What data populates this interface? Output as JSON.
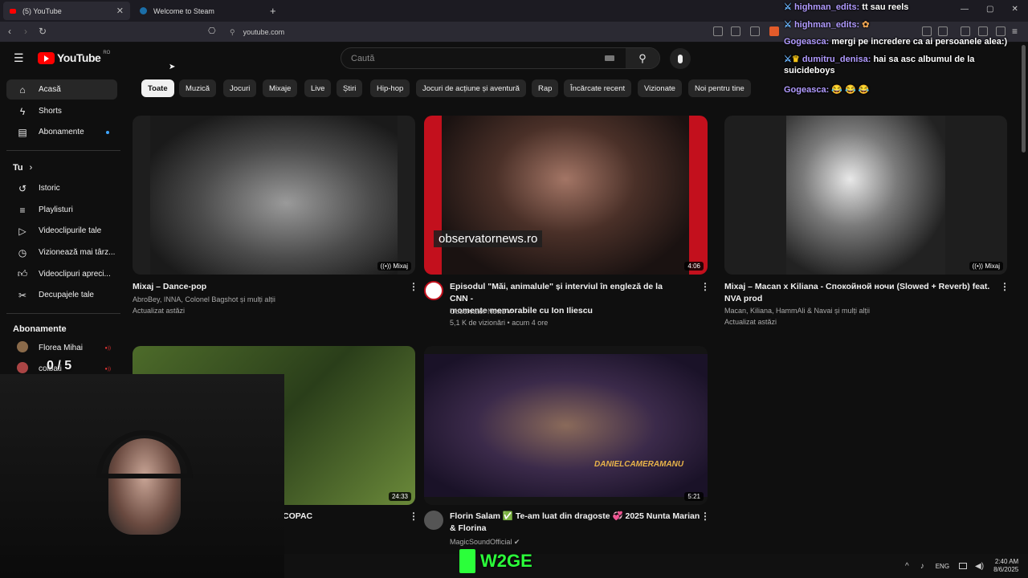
{
  "browser": {
    "tabs": [
      {
        "title": "(5) YouTube",
        "active": true
      },
      {
        "title": "Welcome to Steam",
        "active": false
      }
    ],
    "new_tab": "+",
    "url": "youtube.com",
    "window_controls": [
      "—",
      "▢",
      "✕"
    ]
  },
  "youtube": {
    "logo": "YouTube",
    "region": "RO",
    "search_placeholder": "Caută",
    "sidebar": {
      "main": [
        {
          "label": "Acasă",
          "icon": "home-icon",
          "selected": true
        },
        {
          "label": "Shorts",
          "icon": "shorts-icon"
        },
        {
          "label": "Abonamente",
          "icon": "subscriptions-icon"
        }
      ],
      "you_header": "Tu",
      "you": [
        {
          "label": "Istoric",
          "icon": "history-icon"
        },
        {
          "label": "Playlisturi",
          "icon": "playlist-icon"
        },
        {
          "label": "Videoclipurile tale",
          "icon": "your-videos-icon"
        },
        {
          "label": "Vizionează mai târz...",
          "icon": "watch-later-icon"
        },
        {
          "label": "Videoclipuri apreci...",
          "icon": "like-icon"
        },
        {
          "label": "Decupajele tale",
          "icon": "clips-icon"
        }
      ],
      "subs_header": "Abonamente",
      "subs": [
        {
          "label": "Florea Mihai"
        },
        {
          "label": "colbati"
        }
      ]
    },
    "chips": [
      "Toate",
      "Muzică",
      "Jocuri",
      "Mixaje",
      "Live",
      "Știri",
      "Hip-hop",
      "Jocuri de acțiune și aventură",
      "Rap",
      "Încărcate recent",
      "Vizionate",
      "Noi pentru tine"
    ],
    "videos": [
      {
        "title": "Mixaj – Dance-pop",
        "line2": "",
        "meta1": "AbroBey, INNA, Colonel Bagshot și mulți alții",
        "meta2": "Actualizat astăzi",
        "badge": "Mixaj"
      },
      {
        "title": "Episodul \"Măi, animalule\" și interviul în engleză de la CNN -",
        "line2": "momente memorabile cu Ion Iliescu",
        "meta1": "Observator News ✔",
        "meta2": "5,1 K de vizionări • acum 4 ore",
        "badge": "4:06",
        "overlay_text": "observatornews.ro"
      },
      {
        "title": "Mixaj – Macan x Kiliana  - Спокойной ночи  (Slowed + Reverb) feat.",
        "line2": "NVA prod",
        "meta1": "Macan, Kiliana, HammAli & Navai și mulți alții",
        "meta2": "Actualizat astăzi",
        "badge": "Mixaj"
      },
      {
        "title": "COPAC",
        "line2": "",
        "meta1": "",
        "meta2": "",
        "badge": "24:33"
      },
      {
        "title": "Florin Salam ✅ Te-am luat din dragoste 💞 2025 Nunta Marian",
        "line2": "& Florina",
        "meta1": "MagicSoundOfficial ✔",
        "meta2": "",
        "badge": "5:21",
        "overlay_text": "DANIELCAMERAMANU"
      }
    ]
  },
  "chat": [
    {
      "user": "highman_edits:",
      "msg": "tt sau reels"
    },
    {
      "user": "highman_edits:",
      "msg": ""
    },
    {
      "user": "Gogeasca:",
      "msg": "mergi pe incredere ca ai persoanele alea:)"
    },
    {
      "user": "dumitru_denisa:",
      "msg": "hai sa asc albumul de la suicideboys"
    },
    {
      "user": "Gogeasca:",
      "msg": "😂 😂 😂"
    }
  ],
  "overlay": {
    "score": "0 / 5",
    "brand": "W2GE"
  },
  "taskbar": {
    "lang": "ENG",
    "time": "2:40 AM",
    "date": "8/6/2025"
  }
}
